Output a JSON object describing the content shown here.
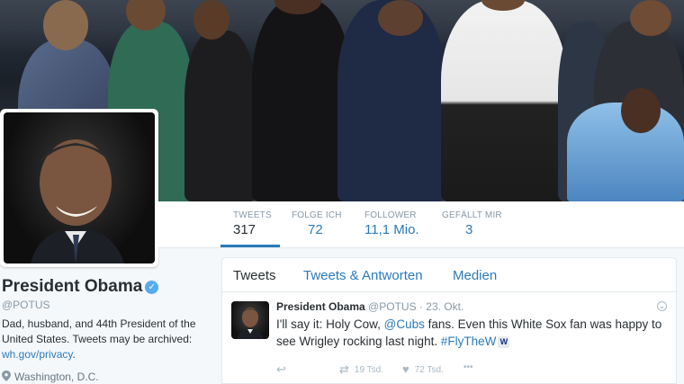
{
  "profile": {
    "name": "President Obama",
    "verified_glyph": "✓",
    "handle": "@POTUS",
    "bio_text": "Dad, husband, and 44th President of the United States. Tweets may be archived: ",
    "bio_link": "wh.gov/privacy",
    "bio_end": ".",
    "location": "Washington, D.C.",
    "location_icon": "map-pin-icon"
  },
  "stats": [
    {
      "label": "TWEETS",
      "value": "317"
    },
    {
      "label": "FOLGE ICH",
      "value": "72"
    },
    {
      "label": "FOLLOWER",
      "value": "11,1 Mio."
    },
    {
      "label": "GEFÄLLT MIR",
      "value": "3"
    }
  ],
  "tabs": [
    {
      "label": "Tweets"
    },
    {
      "label": "Tweets & Antworten"
    },
    {
      "label": "Medien"
    }
  ],
  "tweet": {
    "author": "President Obama",
    "handle": "@POTUS",
    "separator": "·",
    "date": "23. Okt.",
    "text_1": "I'll say it: Holy Cow, ",
    "mention": "@Cubs",
    "text_2": " fans. Even this White Sox fan was happy to see Wrigley rocking last night. ",
    "hashtag": "#FlyTheW",
    "emoji": "W",
    "retweets": "19 Tsd.",
    "likes": "72 Tsd.",
    "more": "•••"
  },
  "colors": {
    "link": "#2b7bb9",
    "verified": "#55acee",
    "muted": "#8899a6"
  }
}
